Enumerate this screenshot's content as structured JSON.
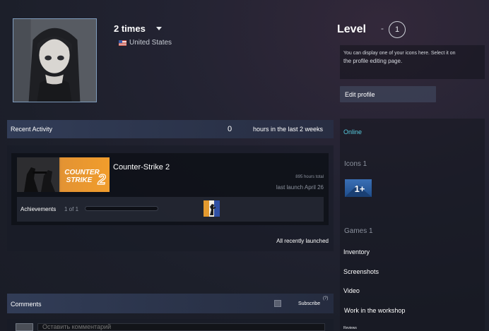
{
  "profile": {
    "persona_name": "2 times",
    "location": "United States",
    "level_label": "Level",
    "level_dash": "-",
    "level_value": "1",
    "icon_info_line1": "You can display one of your icons here. Select it on",
    "icon_info_line2": "the profile editing page.",
    "edit_profile_label": "Edit profile"
  },
  "recent_activity": {
    "title": "Recent Activity",
    "hours_value": "0",
    "hours_label": "hours in the last 2 weeks",
    "game": {
      "name": "Counter-Strike 2",
      "capsule_text_1": "COUNTER",
      "capsule_text_2": "STRIKE",
      "hours_total": "895 hours total",
      "last_launch": "last launch April 26",
      "achievements_label": "Achievements",
      "achievements_count": "1 of 1",
      "achievements_progress": 0.0
    },
    "all_recently_launched": "All recently launched"
  },
  "sidebar": {
    "status": "Online",
    "icons_label": "Icons 1",
    "icon_badge_text": "1+",
    "games_label": "Games 1",
    "links": {
      "inventory": "Inventory",
      "screenshots": "Screenshots",
      "video": "Video",
      "workshop": "Work in the workshop",
      "reviews": "Reviews"
    }
  },
  "comments": {
    "title": "Comments",
    "subscribe_label": "Subscribe",
    "help_label": "(?)",
    "input_placeholder": "Оставить комментарий"
  },
  "colors": {
    "accent_online": "#57cbde",
    "header_band": "#34405c",
    "capsule_orange": "#f19d2c"
  }
}
